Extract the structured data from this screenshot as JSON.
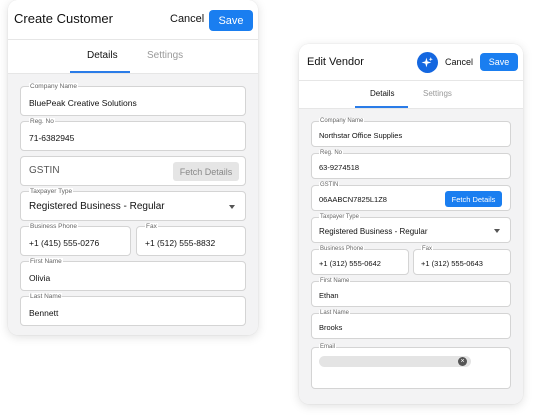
{
  "create_customer": {
    "title": "Create Customer",
    "cancel_label": "Cancel",
    "save_label": "Save",
    "tabs": [
      {
        "label": "Details",
        "active": true
      },
      {
        "label": "Settings",
        "active": false
      }
    ],
    "fields": {
      "company_name": {
        "label": "Company Name",
        "value": "BluePeak Creative Solutions"
      },
      "reg_no": {
        "label": "Reg. No",
        "value": "71-6382945"
      },
      "gstin": {
        "placeholder": "GSTIN",
        "fetch_label": "Fetch Details",
        "fetch_enabled": false
      },
      "taxpayer_type": {
        "label": "Taxpayer Type",
        "value": "Registered Business - Regular"
      },
      "business_phone": {
        "label": "Business Phone",
        "value": "+1 (415) 555-0276"
      },
      "fax": {
        "label": "Fax",
        "value": "+1 (512) 555-8832"
      },
      "first_name": {
        "label": "First Name",
        "value": "Olivia"
      },
      "last_name": {
        "label": "Last Name",
        "value": "Bennett"
      }
    }
  },
  "edit_vendor": {
    "title": "Edit Vendor",
    "ai_icon": "sparkle-icon",
    "cancel_label": "Cancel",
    "save_label": "Save",
    "tabs": [
      {
        "label": "Details",
        "active": true
      },
      {
        "label": "Settings",
        "active": false
      }
    ],
    "fields": {
      "company_name": {
        "label": "Company Name",
        "value": "Northstar Office Supplies"
      },
      "reg_no": {
        "label": "Reg. No",
        "value": "63-9274518"
      },
      "gstin": {
        "label": "GSTIN",
        "value": "06AABCN7825L1Z8",
        "fetch_label": "Fetch Details",
        "fetch_enabled": true
      },
      "taxpayer_type": {
        "label": "Taxpayer Type",
        "value": "Registered Business - Regular"
      },
      "business_phone": {
        "label": "Business Phone",
        "value": "+1 (312) 555-0642"
      },
      "fax": {
        "label": "Fax",
        "value": "+1 (312) 555-0643"
      },
      "first_name": {
        "label": "First Name",
        "value": "Ethan"
      },
      "last_name": {
        "label": "Last Name",
        "value": "Brooks"
      },
      "email": {
        "label": "Email",
        "chip_value": ""
      }
    }
  },
  "colors": {
    "accent": "#1a7ef0",
    "tab_indicator": "#2a7ce8",
    "body_bg": "#f3f3f4",
    "ai_button": "#1467e0"
  }
}
